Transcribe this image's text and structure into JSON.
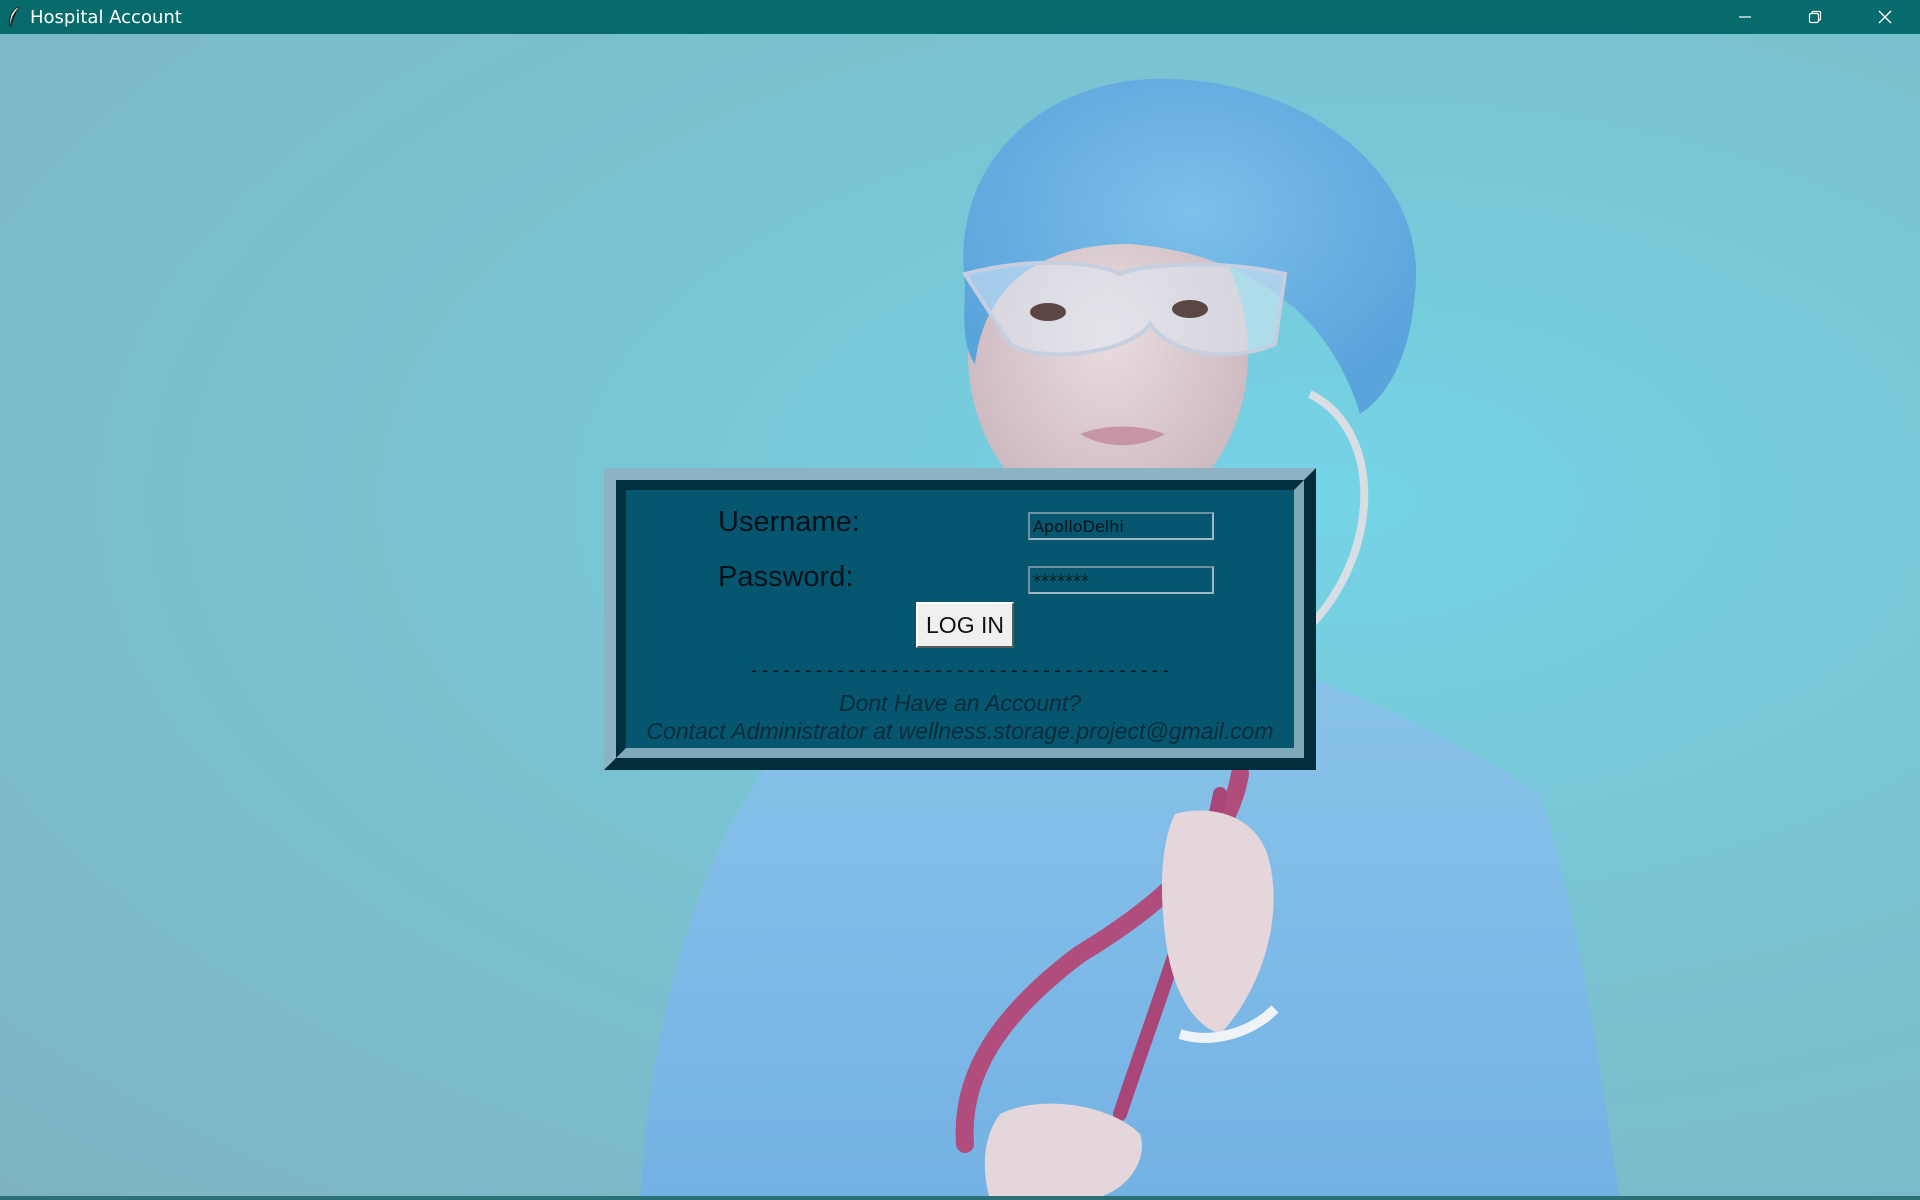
{
  "window": {
    "title": "Hospital Account",
    "app_icon": "feather-icon",
    "controls": [
      "minimize-icon",
      "restore-icon",
      "close-icon"
    ]
  },
  "colors": {
    "titlebar": "#086b6b",
    "frame": "#06566f",
    "background": "#7fc4d3"
  },
  "background_image": {
    "icon": "doctor-photo"
  },
  "login": {
    "username_label": "Username:",
    "username_value": "ApolloDelhi",
    "password_label": "Password:",
    "password_value": "*******",
    "login_button": "LOG IN",
    "divider": "---------------------------------------",
    "no_account": "Dont Have an Account?",
    "contact": "Contact Administrator at wellness.storage.project@gmail.com"
  }
}
